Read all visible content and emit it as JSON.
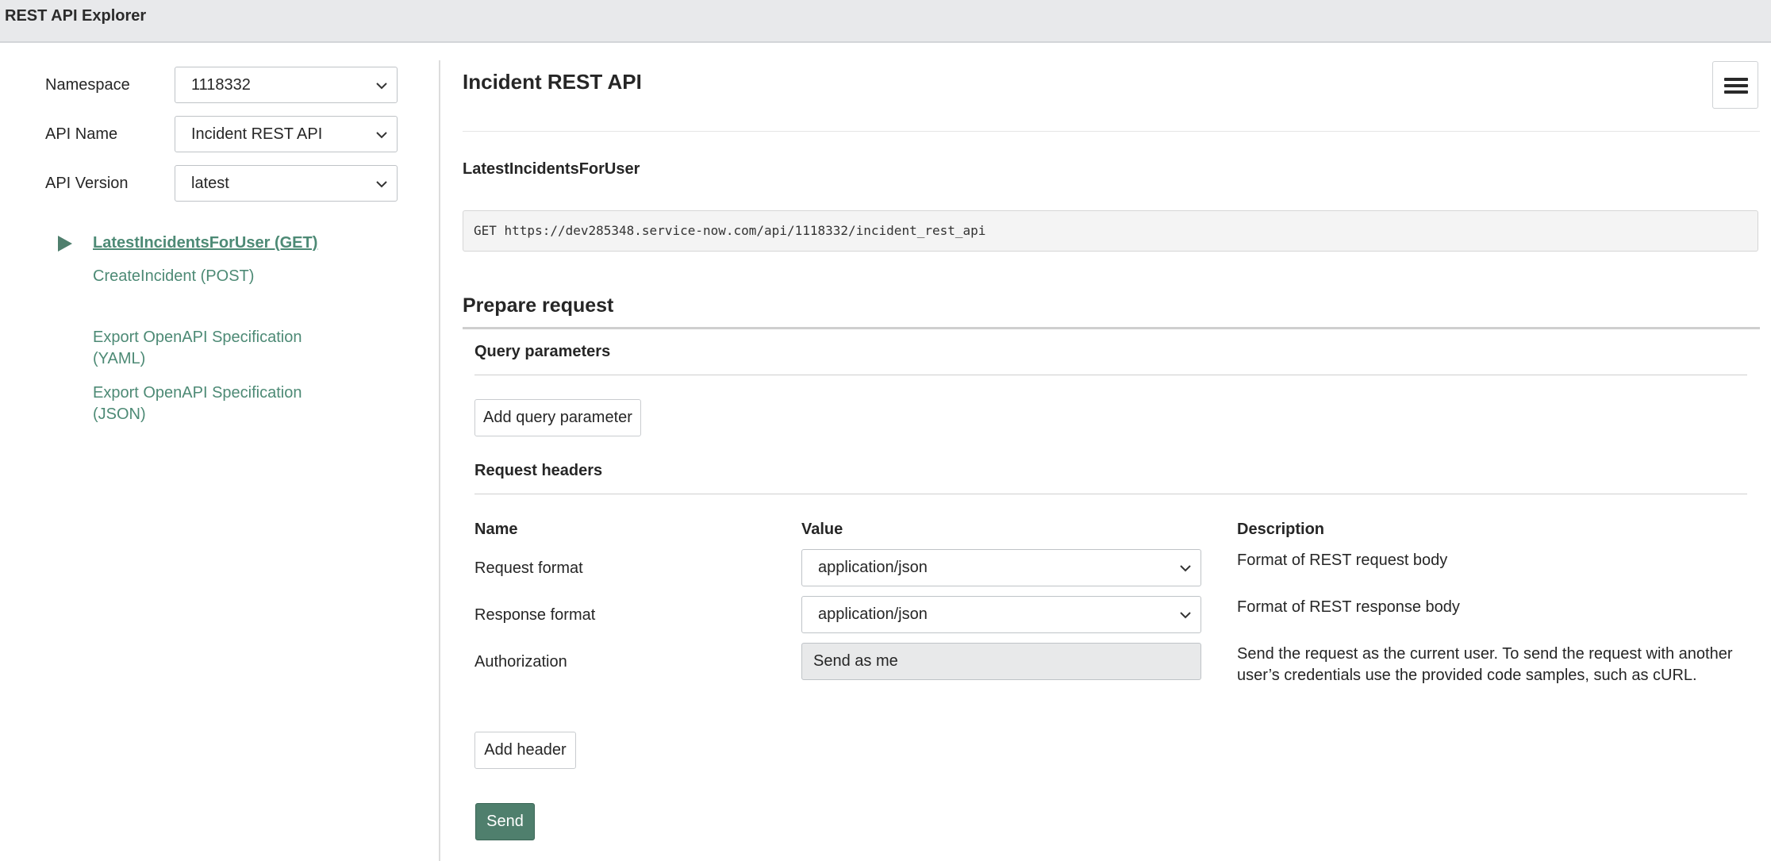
{
  "app": {
    "title": "REST API Explorer"
  },
  "sidebar": {
    "namespace": {
      "label": "Namespace",
      "value": "1118332"
    },
    "api_name": {
      "label": "API Name",
      "value": "Incident REST API"
    },
    "api_version": {
      "label": "API Version",
      "value": "latest"
    },
    "methods": [
      {
        "label": "LatestIncidentsForUser  (GET)",
        "active": true
      },
      {
        "label": "CreateIncident  (POST)",
        "active": false
      }
    ],
    "exports": [
      {
        "label": "Export OpenAPI Specification (YAML)"
      },
      {
        "label": "Export OpenAPI Specification (JSON)"
      }
    ]
  },
  "main": {
    "api_title": "Incident REST API",
    "method_title": "LatestIncidentsForUser",
    "request_url": "GET https://dev285348.service-now.com/api/1118332/incident_rest_api",
    "prepare_title": "Prepare request",
    "query_params": {
      "title": "Query parameters",
      "add_label": "Add query parameter"
    },
    "headers": {
      "title": "Request headers",
      "columns": {
        "name": "Name",
        "value": "Value",
        "description": "Description"
      },
      "rows": [
        {
          "name": "Request format",
          "value": "application/json",
          "description": "Format of REST request body"
        },
        {
          "name": "Response format",
          "value": "application/json",
          "description": "Format of REST response body"
        },
        {
          "name": "Authorization",
          "value": "Send as me",
          "description": "Send the request as the current user. To send the request with another user’s credentials use the provided code samples, such as cURL."
        }
      ],
      "add_label": "Add header"
    },
    "send_label": "Send"
  },
  "colors": {
    "accent": "#4f7f6d",
    "link": "#4d8a75",
    "topbar": "#e8e9eb"
  },
  "icons": {
    "menu": "hamburger-menu-icon",
    "method_arrow": "play-triangle-icon",
    "select_chevron": "chevron-down-icon"
  }
}
